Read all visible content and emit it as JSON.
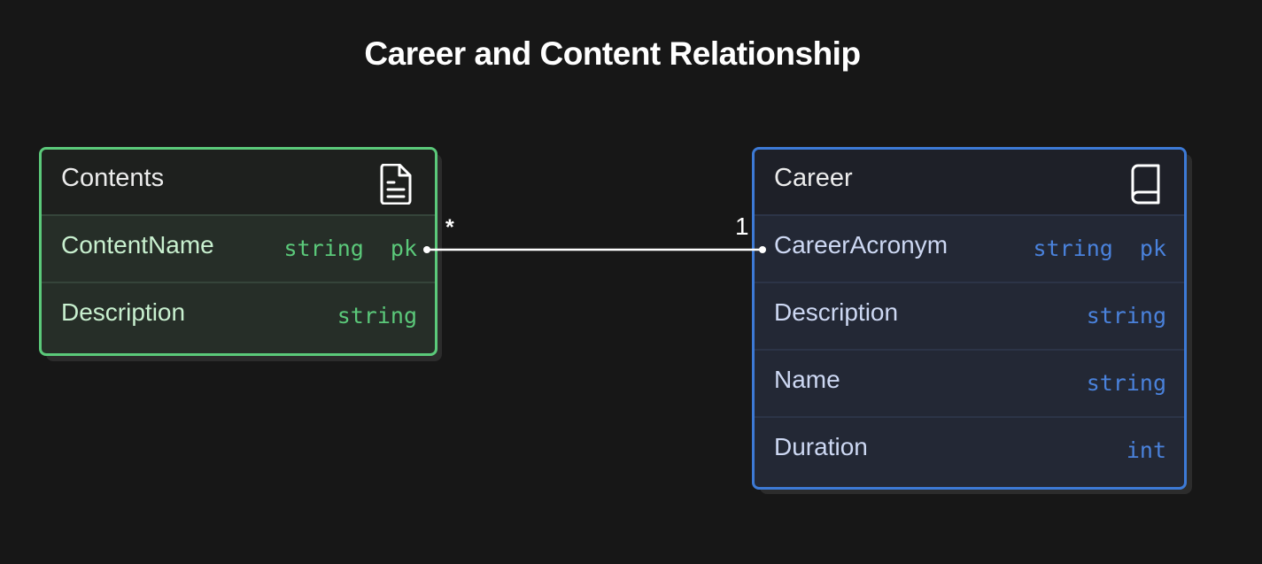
{
  "title": "Career and Content Relationship",
  "entities": {
    "contents": {
      "name": "Contents",
      "icon": "document-icon",
      "color": "#5bc97a",
      "attributes": [
        {
          "name": "ContentName",
          "type": "string  pk"
        },
        {
          "name": "Description",
          "type": "string"
        }
      ]
    },
    "career": {
      "name": "Career",
      "icon": "book-icon",
      "color": "#3d7ad6",
      "attributes": [
        {
          "name": "CareerAcronym",
          "type": "string  pk"
        },
        {
          "name": "Description",
          "type": "string"
        },
        {
          "name": "Name",
          "type": "string"
        },
        {
          "name": "Duration",
          "type": "int"
        }
      ]
    }
  },
  "relationship": {
    "from_cardinality": "*",
    "to_cardinality": "1"
  }
}
